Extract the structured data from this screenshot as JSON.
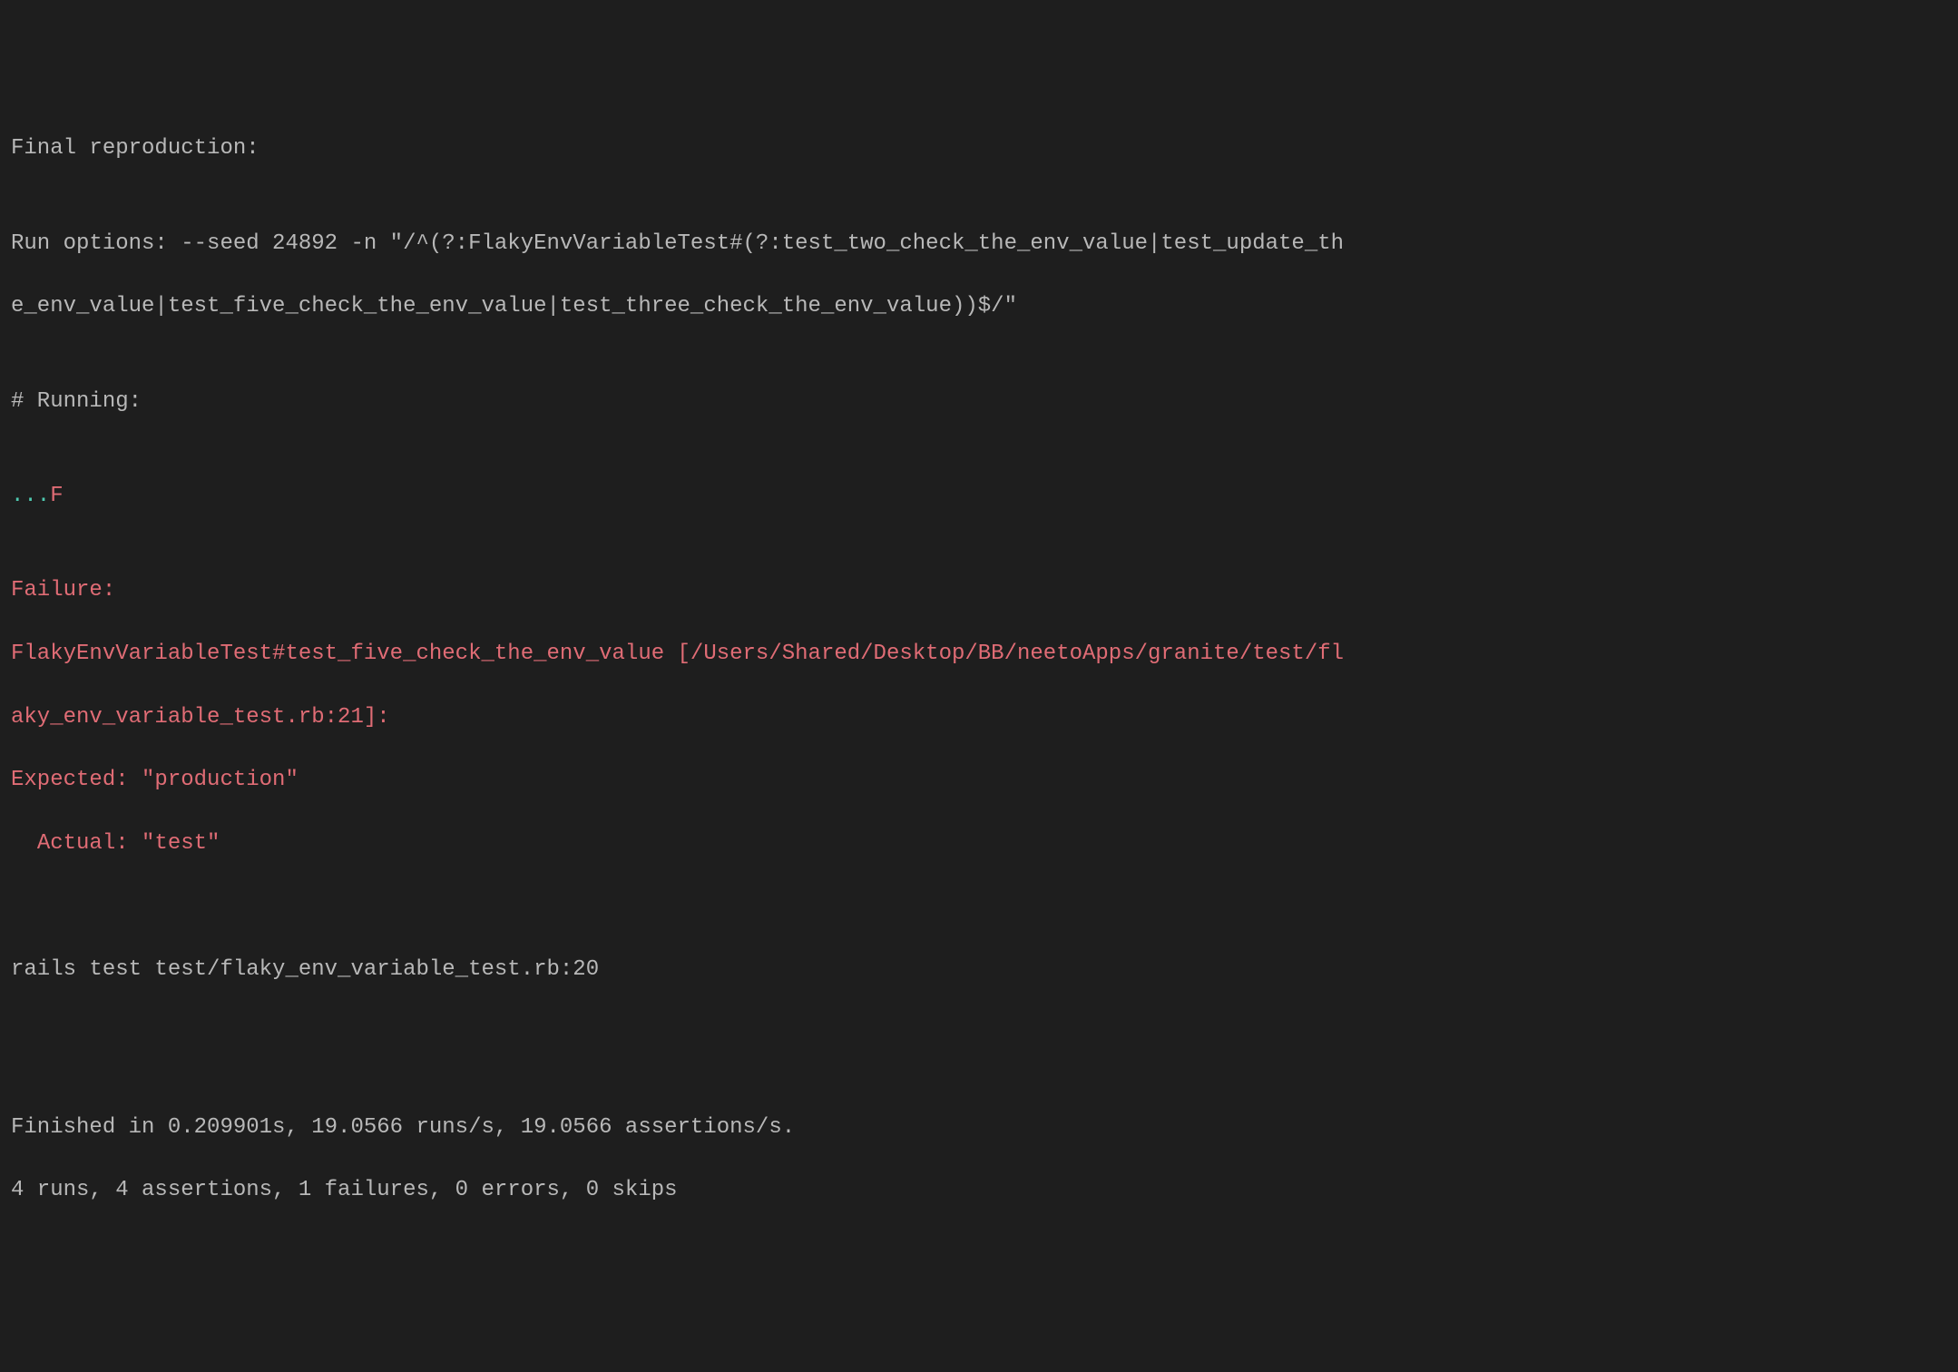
{
  "terminal": {
    "final_reproduction_label": "Final reproduction:",
    "run_options_line1": "Run options: --seed 24892 -n \"/^(?:FlakyEnvVariableTest#(?:test_two_check_the_env_value|test_update_th",
    "run_options_line2": "e_env_value|test_five_check_the_env_value|test_three_check_the_env_value))$/\"",
    "running_label": "# Running:",
    "pass_dots": "...",
    "fail_marker": "F",
    "failure_label": "Failure:",
    "failure_line1": "FlakyEnvVariableTest#test_five_check_the_env_value [/Users/Shared/Desktop/BB/neetoApps/granite/test/fl",
    "failure_line2": "aky_env_variable_test.rb:21]:",
    "expected_line": "Expected: \"production\"",
    "actual_line": "  Actual: \"test\"",
    "rails_test_line": "rails test test/flaky_env_variable_test.rb:20",
    "finished_line": "Finished in 0.209901s, 19.0566 runs/s, 19.0566 assertions/s.",
    "summary_line": "4 runs, 4 assertions, 1 failures, 0 errors, 0 skips"
  }
}
